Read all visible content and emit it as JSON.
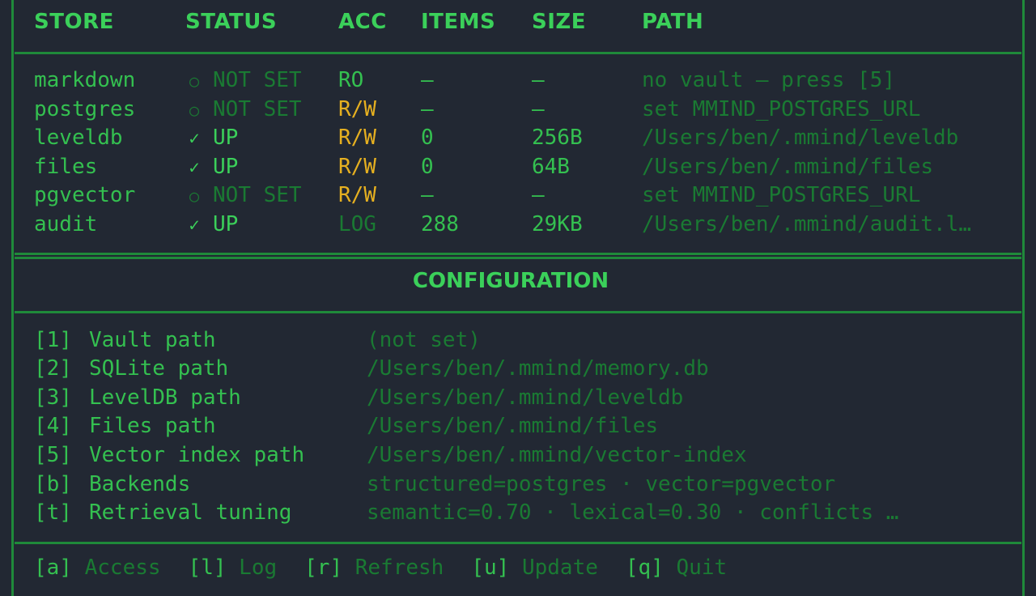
{
  "table": {
    "headers": [
      "STORE",
      "STATUS",
      "ACC",
      "ITEMS",
      "SIZE",
      "PATH"
    ],
    "rows": [
      {
        "store": "markdown",
        "status_icon": "circle-icon",
        "status": "NOT SET",
        "acc": "RO",
        "items": "—",
        "size": "—",
        "path": "no vault — press [5]"
      },
      {
        "store": "postgres",
        "status_icon": "circle-icon",
        "status": "NOT SET",
        "acc": "R/W",
        "items": "—",
        "size": "—",
        "path": "set MMIND_POSTGRES_URL"
      },
      {
        "store": "leveldb",
        "status_icon": "check-icon",
        "status": "UP",
        "acc": "R/W",
        "items": "0",
        "size": "256B",
        "path": "/Users/ben/.mmind/leveldb"
      },
      {
        "store": "files",
        "status_icon": "check-icon",
        "status": "UP",
        "acc": "R/W",
        "items": "0",
        "size": "64B",
        "path": "/Users/ben/.mmind/files"
      },
      {
        "store": "pgvector",
        "status_icon": "circle-icon",
        "status": "NOT SET",
        "acc": "R/W",
        "items": "—",
        "size": "—",
        "path": "set MMIND_POSTGRES_URL"
      },
      {
        "store": "audit",
        "status_icon": "check-icon",
        "status": "UP",
        "acc": "LOG",
        "items": "288",
        "size": "29KB",
        "path": "/Users/ben/.mmind/audit.l…"
      }
    ]
  },
  "configuration": {
    "title": "CONFIGURATION",
    "items": [
      {
        "key": "[1]",
        "label": "Vault path",
        "value": "(not set)"
      },
      {
        "key": "[2]",
        "label": "SQLite path",
        "value": "/Users/ben/.mmind/memory.db"
      },
      {
        "key": "[3]",
        "label": "LevelDB path",
        "value": "/Users/ben/.mmind/leveldb"
      },
      {
        "key": "[4]",
        "label": "Files path",
        "value": "/Users/ben/.mmind/files"
      },
      {
        "key": "[5]",
        "label": "Vector index path",
        "value": "/Users/ben/.mmind/vector-index"
      },
      {
        "key": "[b]",
        "label": "Backends",
        "value": "structured=postgres  ·  vector=pgvector"
      },
      {
        "key": "[t]",
        "label": "Retrieval tuning",
        "value": "semantic=0.70  ·  lexical=0.30  ·  conflicts …"
      }
    ]
  },
  "footer": {
    "actions": [
      {
        "key": "[a]",
        "label": "Access"
      },
      {
        "key": "[l]",
        "label": "Log"
      },
      {
        "key": "[r]",
        "label": "Refresh"
      },
      {
        "key": "[u]",
        "label": "Update"
      },
      {
        "key": "[q]",
        "label": "Quit"
      }
    ]
  },
  "colors": {
    "background": "#222833",
    "border": "#1f8a3a",
    "bright_green": "#3bd05a",
    "dim_green": "#1a7a33",
    "amber": "#e6b020"
  }
}
